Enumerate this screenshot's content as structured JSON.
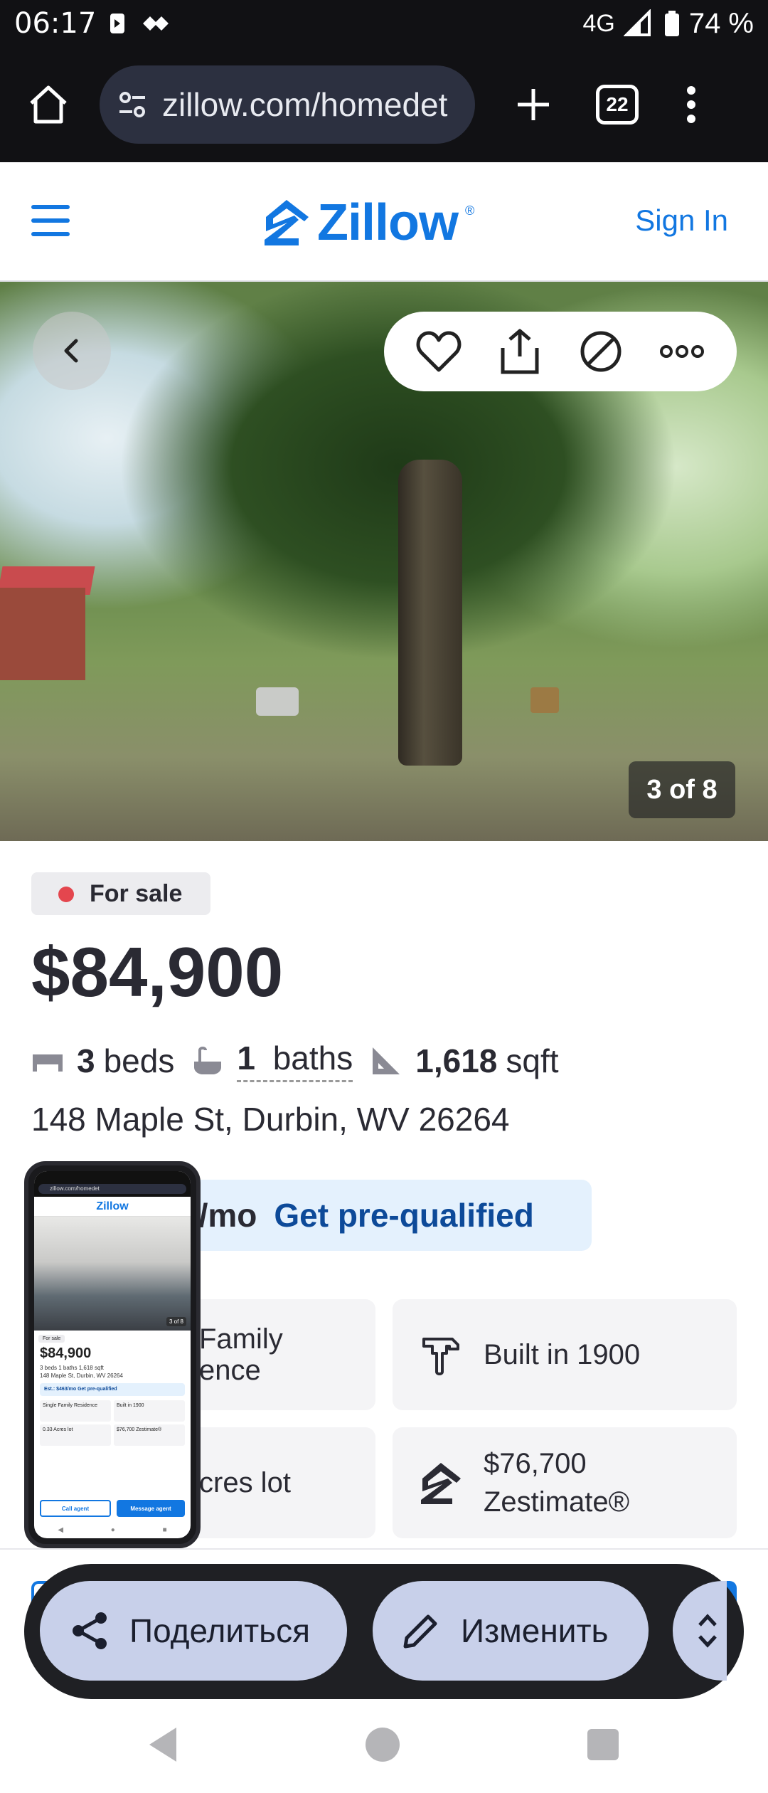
{
  "status_bar": {
    "time": "06:17",
    "network": "4G",
    "battery": "74 %"
  },
  "browser": {
    "url": "zillow.com/homedet",
    "tab_count": "22"
  },
  "header": {
    "logo": "Zillow",
    "sign_in": "Sign In"
  },
  "photo": {
    "counter": "3 of 8"
  },
  "listing": {
    "status": "For sale",
    "price": "$84,900",
    "beds_num": "3",
    "beds_label": "beds",
    "baths_num": "1",
    "baths_label": "baths",
    "sqft_num": "1,618",
    "sqft_label": "sqft",
    "address": "148 Maple St, Durbin, WV 26264",
    "prequal_est": "3/mo",
    "prequal_link": "Get pre-qualified",
    "cards": {
      "type_line1": "Family",
      "type_line2": "ence",
      "built": "Built in 1900",
      "lot": "cres lot",
      "zestimate_value": "$76,700",
      "zestimate_label": "Zestimate®"
    }
  },
  "thumbnail": {
    "url": "zillow.com/homedet",
    "logo": "Zillow",
    "counter": "3 of 8",
    "badge": "For sale",
    "price": "$84,900",
    "facts": "3 beds  1 baths  1,618 sqft",
    "address": "148 Maple St, Durbin, WV 26264",
    "prequal": "Est.: $463/mo  Get pre-qualified",
    "card1": "Single Family Residence",
    "card2": "Built in 1900",
    "card3": "0.33 Acres lot",
    "card4": "$76,700 Zestimate®",
    "call": "Call agent",
    "message": "Message agent"
  },
  "share_toolbar": {
    "share_label": "Поделиться",
    "edit_label": "Изменить"
  },
  "colors": {
    "brand": "#1277e1",
    "for_sale_dot": "#e4464e",
    "prequal_bg": "#e4f1fd"
  }
}
